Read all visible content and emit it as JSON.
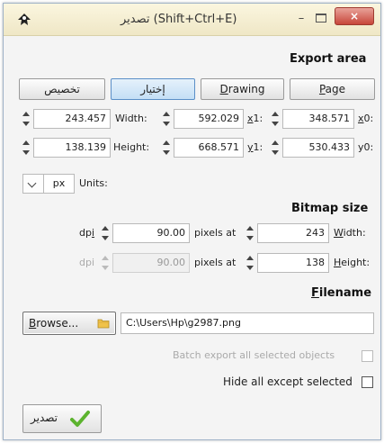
{
  "window": {
    "title": "تصدير (Shift+Ctrl+E)",
    "minimize": "–",
    "close": "×"
  },
  "export_area": {
    "heading": "Export area",
    "buttons": [
      {
        "label": "تخصيص",
        "active": false
      },
      {
        "label": "إختيار",
        "active": true
      },
      {
        "label": "Drawing",
        "active": false
      },
      {
        "label": "Page",
        "active": false
      }
    ],
    "row1": {
      "x0": "243.457",
      "width_label": "Width:",
      "width": "592.029",
      "x1_label": "x1:",
      "x1": "348.571",
      "x0_label": "x0:"
    },
    "row2": {
      "y0": "138.139",
      "height_label": "Height:",
      "height": "668.571",
      "y1_label": "y1:",
      "y1": "530.433",
      "y0_label": "y0:"
    },
    "units": {
      "value": "px",
      "label": "Units:"
    }
  },
  "bitmap": {
    "heading": "Bitmap size",
    "row1": {
      "dpi_label": "dpi",
      "dpi": "90.00",
      "pixels_at": "pixels at",
      "width": "243",
      "width_label": "Width:"
    },
    "row2": {
      "dpi_label": "dpi",
      "dpi": "90.00",
      "pixels_at": "pixels at",
      "height": "138",
      "height_label": "Height:"
    }
  },
  "file": {
    "heading": "Filename",
    "browse_label": "Browse...",
    "path": "C:\\Users\\Hp\\g2987.png"
  },
  "options": {
    "batch_label": "Batch export all selected objects",
    "hide_label": "Hide all except selected"
  },
  "export_button": {
    "label": "تصدير"
  }
}
